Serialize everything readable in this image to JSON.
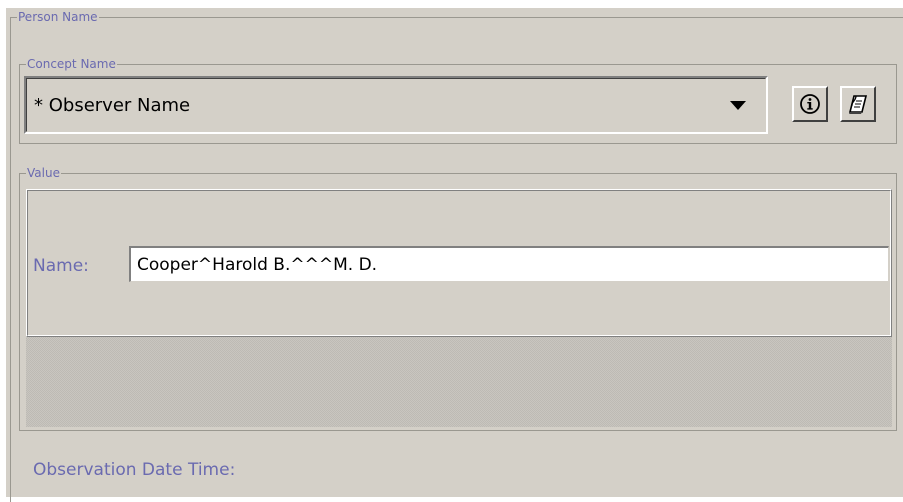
{
  "person_group": {
    "title": "Person Name"
  },
  "concept_group": {
    "title": "Concept Name",
    "combo": {
      "selected": "* Observer Name"
    },
    "buttons": {
      "info_icon": "info-icon",
      "edit_icon": "edit-note-icon"
    }
  },
  "value_group": {
    "title": "Value",
    "name_label": "Name:",
    "name_value": "Cooper^Harold B.^^^M. D."
  },
  "observation": {
    "label": "Observation Date Time:"
  },
  "colors": {
    "panel_bg": "#d4d0c8",
    "label_text": "#6a6ab0",
    "border": "#9a9890"
  }
}
